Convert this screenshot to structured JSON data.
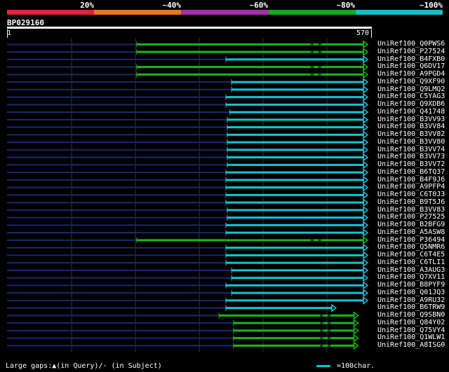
{
  "header": {
    "scale_labels": [
      "20%",
      "~40%",
      "~60%",
      "~80%",
      "~100%"
    ],
    "scale_colors": [
      "#e8203a",
      "#e87820",
      "#a030a8",
      "#10a820",
      "#10c0c8"
    ],
    "query_id": "BP029160",
    "ruler_start": "1",
    "ruler_end": "570"
  },
  "colors": {
    "background": "#000000",
    "grid": "#333333",
    "query_line": "#ffffff",
    "low_line": "#1a2a6e",
    "green": "#18b818",
    "cyan": "#10c8d0"
  },
  "query_length": 570,
  "hits": [
    {
      "label": "UniRef100_Q0PWS6",
      "color": "green",
      "start": 205,
      "end": 570,
      "gap": 480
    },
    {
      "label": "UniRef100_P27524",
      "color": "green",
      "start": 205,
      "end": 570,
      "gap": 480
    },
    {
      "label": "UniRef100_B4FXB0",
      "color": "cyan",
      "start": 346,
      "end": 570
    },
    {
      "label": "UniRef100_Q6DV17",
      "color": "green",
      "start": 205,
      "end": 570,
      "gap": 480
    },
    {
      "label": "UniRef100_A9PGD4",
      "color": "green",
      "start": 205,
      "end": 570,
      "gap": 480
    },
    {
      "label": "UniRef100_Q9XF90",
      "color": "cyan",
      "start": 355,
      "end": 570
    },
    {
      "label": "UniRef100_Q9LMQ2",
      "color": "cyan",
      "start": 355,
      "end": 570
    },
    {
      "label": "UniRef100_C5YAG3",
      "color": "cyan",
      "start": 346,
      "end": 570
    },
    {
      "label": "UniRef100_Q9XDB6",
      "color": "cyan",
      "start": 346,
      "end": 570
    },
    {
      "label": "UniRef100_Q41748",
      "color": "cyan",
      "start": 352,
      "end": 570
    },
    {
      "label": "UniRef100_B3VV93",
      "color": "cyan",
      "start": 348,
      "end": 570
    },
    {
      "label": "UniRef100_B3VV84",
      "color": "cyan",
      "start": 348,
      "end": 570
    },
    {
      "label": "UniRef100_B3VV82",
      "color": "cyan",
      "start": 348,
      "end": 570
    },
    {
      "label": "UniRef100_B3VV80",
      "color": "cyan",
      "start": 348,
      "end": 570
    },
    {
      "label": "UniRef100_B3VV74",
      "color": "cyan",
      "start": 348,
      "end": 570
    },
    {
      "label": "UniRef100_B3VV73",
      "color": "cyan",
      "start": 348,
      "end": 570
    },
    {
      "label": "UniRef100_B3VV72",
      "color": "cyan",
      "start": 348,
      "end": 570
    },
    {
      "label": "UniRef100_B6TQ37",
      "color": "cyan",
      "start": 346,
      "end": 570
    },
    {
      "label": "UniRef100_B4F9J6",
      "color": "cyan",
      "start": 346,
      "end": 570
    },
    {
      "label": "UniRef100_A9PFP4",
      "color": "cyan",
      "start": 346,
      "end": 570
    },
    {
      "label": "UniRef100_C6T0J3",
      "color": "cyan",
      "start": 346,
      "end": 570
    },
    {
      "label": "UniRef100_B9T5J6",
      "color": "cyan",
      "start": 346,
      "end": 570
    },
    {
      "label": "UniRef100_B3VV83",
      "color": "cyan",
      "start": 348,
      "end": 570
    },
    {
      "label": "UniRef100_P27525",
      "color": "cyan",
      "start": 348,
      "end": 570
    },
    {
      "label": "UniRef100_B2BFG9",
      "color": "cyan",
      "start": 346,
      "end": 570
    },
    {
      "label": "UniRef100_A5ASW8",
      "color": "cyan",
      "start": 346,
      "end": 570
    },
    {
      "label": "UniRef100_P36494",
      "color": "green",
      "start": 205,
      "end": 570,
      "gap": 480
    },
    {
      "label": "UniRef100_Q5NMR6",
      "color": "cyan",
      "start": 346,
      "end": 570
    },
    {
      "label": "UniRef100_C6T4E5",
      "color": "cyan",
      "start": 346,
      "end": 570
    },
    {
      "label": "UniRef100_C6TLI1",
      "color": "cyan",
      "start": 346,
      "end": 570
    },
    {
      "label": "UniRef100_A3AUG3",
      "color": "cyan",
      "start": 355,
      "end": 570
    },
    {
      "label": "UniRef100_Q7XV11",
      "color": "cyan",
      "start": 355,
      "end": 570
    },
    {
      "label": "UniRef100_B8PYF9",
      "color": "cyan",
      "start": 346,
      "end": 570
    },
    {
      "label": "UniRef100_Q01JQ3",
      "color": "cyan",
      "start": 355,
      "end": 570
    },
    {
      "label": "UniRef100_A9RU32",
      "color": "cyan",
      "start": 346,
      "end": 570
    },
    {
      "label": "UniRef100_B6TRW9",
      "color": "cyan",
      "start": 346,
      "end": 520
    },
    {
      "label": "UniRef100_Q9SBN0",
      "color": "green",
      "start": 335,
      "end": 555,
      "gap": 495
    },
    {
      "label": "UniRef100_Q84Y02",
      "color": "green",
      "start": 358,
      "end": 555,
      "gap": 495
    },
    {
      "label": "UniRef100_Q75VY4",
      "color": "green",
      "start": 358,
      "end": 555,
      "gap": 495
    },
    {
      "label": "UniRef100_Q1WLW1",
      "color": "green",
      "start": 358,
      "end": 555,
      "gap": 495
    },
    {
      "label": "UniRef100_A8ISG0",
      "color": "green",
      "start": 358,
      "end": 555,
      "gap": 495
    }
  ],
  "footer": {
    "left_text": "Large gaps:▲(in Query)/- (in Subject)",
    "right_text": "=100char."
  }
}
